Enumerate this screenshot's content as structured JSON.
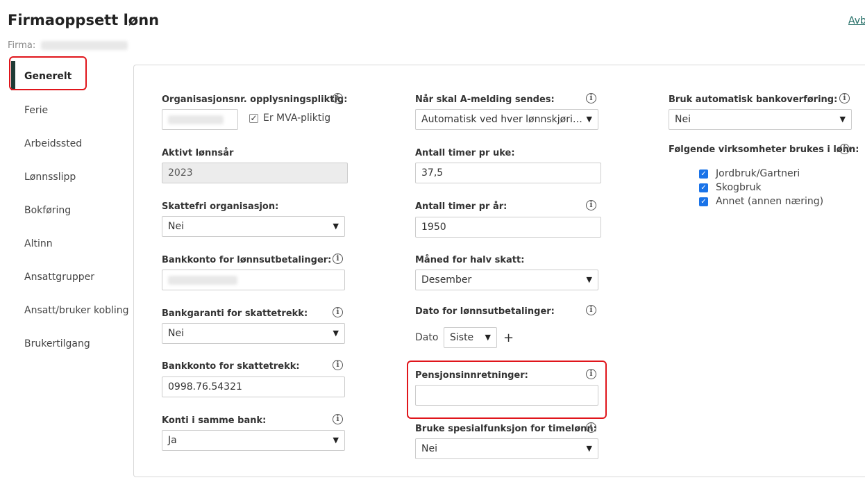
{
  "header": {
    "title": "Firmaoppsett lønn",
    "firma_label": "Firma:",
    "cancel": "Avb"
  },
  "sidebar": {
    "items": [
      {
        "label": "Generelt",
        "active": true
      },
      {
        "label": "Ferie"
      },
      {
        "label": "Arbeidssted"
      },
      {
        "label": "Lønnsslipp"
      },
      {
        "label": "Bokføring"
      },
      {
        "label": "Altinn"
      },
      {
        "label": "Ansattgrupper"
      },
      {
        "label": "Ansatt/bruker kobling"
      },
      {
        "label": "Brukertilgang"
      }
    ]
  },
  "col1": {
    "orgnr_label": "Organisasjonsnr. opplysningspliktig:",
    "mva_label": "Er MVA-pliktig",
    "lonnsar_label": "Aktivt lønnsår",
    "lonnsar_value": "2023",
    "skattefri_label": "Skattefri organisasjon:",
    "skattefri_value": "Nei",
    "bankkonto_lonn_label": "Bankkonto for lønnsutbetalinger:",
    "bankgaranti_label": "Bankgaranti for skattetrekk:",
    "bankgaranti_value": "Nei",
    "bankkonto_skatt_label": "Bankkonto for skattetrekk:",
    "bankkonto_skatt_value": "0998.76.54321",
    "konti_label": "Konti i samme bank:",
    "konti_value": "Ja"
  },
  "col2": {
    "amelding_label": "Når skal A-melding sendes:",
    "amelding_value": "Automatisk ved hver lønnskjøri…",
    "timer_uke_label": "Antall timer pr uke:",
    "timer_uke_value": "37,5",
    "timer_ar_label": "Antall timer pr år:",
    "timer_ar_value": "1950",
    "halv_skatt_label": "Måned for halv skatt:",
    "halv_skatt_value": "Desember",
    "dato_label": "Dato for lønnsutbetalinger:",
    "dato_prefix": "Dato",
    "dato_value": "Siste",
    "add_symbol": "+",
    "pensjon_label": "Pensjonsinnretninger:",
    "pensjon_value": "",
    "spesial_label": "Bruke spesialfunksjon for timelønn:",
    "spesial_value": "Nei"
  },
  "col3": {
    "bankoverforing_label": "Bruk automatisk bankoverføring:",
    "bankoverforing_value": "Nei",
    "virksomheter_label": "Følgende virksomheter brukes i lønn:",
    "virksomheter": [
      {
        "label": "Jordbruk/Gartneri",
        "checked": true
      },
      {
        "label": "Skogbruk",
        "checked": true
      },
      {
        "label": "Annet (annen næring)",
        "checked": true
      }
    ]
  },
  "icons": {
    "info": "info-circle-icon",
    "dropdown": "chevron-down-icon",
    "check": "checkmark-icon"
  },
  "colors": {
    "highlight": "#e0151b",
    "accent": "#1f3b35",
    "checkbox": "#1a73e8",
    "link": "#1f6b63"
  }
}
